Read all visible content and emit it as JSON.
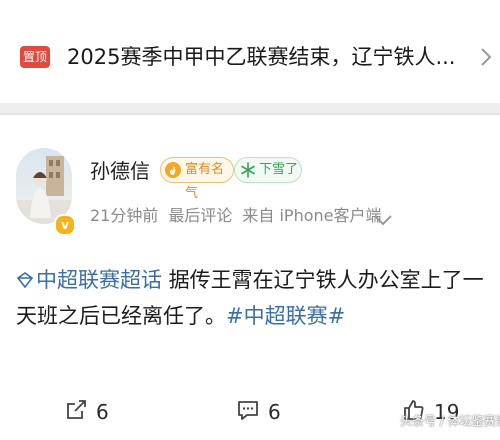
{
  "pinned": {
    "badge": "置顶",
    "title": "2025赛季中甲中乙联赛结束，辽宁铁人..."
  },
  "post": {
    "author": "孙德信",
    "badges": {
      "fame": "富有名气",
      "snow": "下雪了"
    },
    "meta": {
      "time": "21分钟前",
      "status": "最后评论",
      "source": "来自 iPhone客户端"
    },
    "body": {
      "topic": "中超联赛超话",
      "text": "  据传王霄在辽宁铁人办公室上了一天班之后已经离任了。",
      "hashtag": "#中超联赛#"
    },
    "actions": {
      "repost_count": "6",
      "comment_count": "6",
      "like_count": "19"
    }
  },
  "watermark": {
    "text": "头条号 / 体坛鉴赛录"
  },
  "colors": {
    "pin_badge": "#e2493f",
    "link": "#3a6ea5",
    "fame": "#e08a1e",
    "snow": "#37a35a",
    "meta_gray": "#8a8a8a"
  }
}
